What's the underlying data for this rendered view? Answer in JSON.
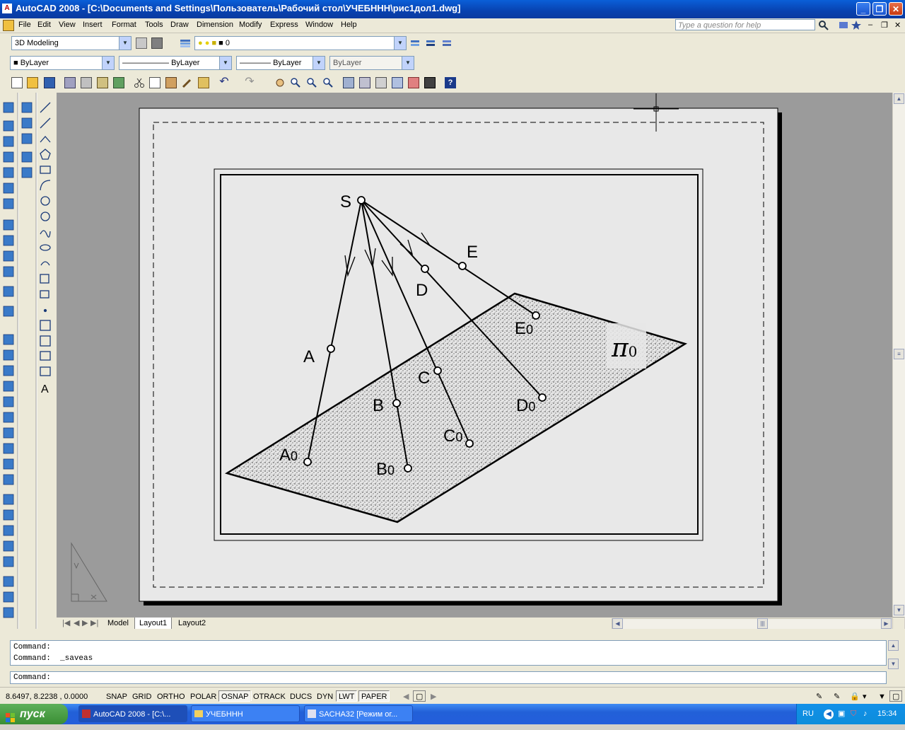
{
  "window": {
    "title": "AutoCAD 2008 - [C:\\Documents and Settings\\Пользователь\\Рабочий стол\\УЧЕБННН\\рис1дол1.dwg]",
    "app_icon": "autocad-icon",
    "controls": [
      "minimize-icon",
      "restore-icon",
      "close-icon"
    ]
  },
  "menu": {
    "items": [
      "File",
      "Edit",
      "View",
      "Insert",
      "Format",
      "Tools",
      "Draw",
      "Dimension",
      "Modify",
      "Express",
      "Window",
      "Help"
    ],
    "help_placeholder": "Type a question for help"
  },
  "toolbars": {
    "workspace": "3D Modeling",
    "layer": "0",
    "color": "ByLayer",
    "linetype": "ByLayer",
    "lineweight": "ByLayer",
    "plotstyle": "ByLayer"
  },
  "drawing": {
    "labels": {
      "S": "S",
      "A": "A",
      "B": "B",
      "C": "C",
      "D": "D",
      "E": "E",
      "A0_base": "A",
      "A0_sub": "0",
      "B0_base": "B",
      "B0_sub": "0",
      "C0_base": "C",
      "C0_sub": "0",
      "D0_base": "D",
      "D0_sub": "0",
      "E0_base": "E",
      "E0_sub": "0",
      "pi_base": "π",
      "pi_sub": "0"
    },
    "ucs_icon": "ucs-triangle-icon"
  },
  "tabs": [
    "Model",
    "Layout1",
    "Layout2"
  ],
  "active_tab": "Layout1",
  "command": {
    "history": [
      "Command:",
      "Command:  _saveas"
    ],
    "prompt": "Command:"
  },
  "status": {
    "coords": "8.6497, 8.2238 , 0.0000",
    "toggles": [
      {
        "label": "SNAP",
        "on": false
      },
      {
        "label": "GRID",
        "on": false
      },
      {
        "label": "ORTHO",
        "on": false
      },
      {
        "label": "POLAR",
        "on": false
      },
      {
        "label": "OSNAP",
        "on": true
      },
      {
        "label": "OTRACK",
        "on": false
      },
      {
        "label": "DUCS",
        "on": false
      },
      {
        "label": "DYN",
        "on": false
      },
      {
        "label": "LWT",
        "on": true
      },
      {
        "label": "PAPER",
        "on": true
      }
    ]
  },
  "taskbar": {
    "start": "пуск",
    "tasks": [
      "AutoCAD 2008 - [C:\\...",
      "УЧЕБННН",
      "SACHA32 [Режим ог..."
    ],
    "lang": "RU",
    "time": "15:34"
  }
}
